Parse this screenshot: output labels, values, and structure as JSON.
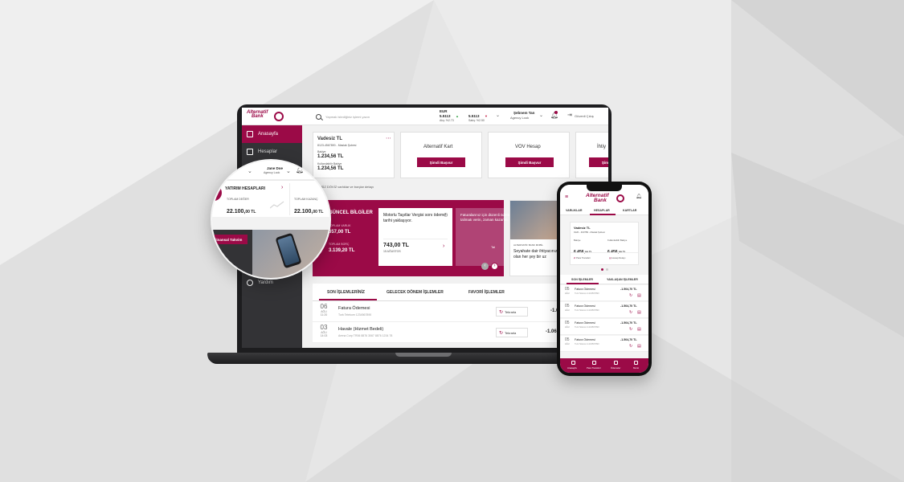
{
  "brand": {
    "name_line1": "Alternatif",
    "name_line2": "Bank",
    "primary_color": "#9b0a47",
    "dark_color": "#333336"
  },
  "laptop": {
    "header": {
      "search_placeholder": "Yapmak istediğiniz işlemi yazın",
      "currency_label": "EUR",
      "rate_buy": "5.5113",
      "rate_buy_sub": "Alış: %2.73",
      "rate_sell": "5.5113",
      "rate_sell_sub": "Satış: %2.50",
      "user_name": "Şebnem Tan",
      "user_role": "Agency Look",
      "logout_label": "Güvenli Çıkış"
    },
    "sidebar": {
      "items": [
        {
          "label": "Anasayfa"
        },
        {
          "label": "Hesaplar"
        },
        {
          "label": "Yardım"
        }
      ]
    },
    "account_card": {
      "title": "Vadesiz TL",
      "account_no": "8123-4567890 - Maslak Şubesi",
      "balance_label": "Bakiye",
      "balance": "1.234,56 TL",
      "available_label": "Kullanılabilir Bakiye",
      "available": "1.234,56 TL"
    },
    "products": [
      {
        "title": "Alternatif Kart",
        "button": "Şimdi Başvur"
      },
      {
        "title": "VOV Hesap",
        "button": "Şimdi Başvur"
      },
      {
        "title": "İhtiy",
        "button": "Şim"
      }
    ],
    "assets_link": "VADESİZ DÖVİZ varlıklar ve borçlar detayı",
    "news": {
      "title": "GÜNCEL BİLGİLER",
      "label1": "TOPLAM VARLIK",
      "value1": "657,00 TL",
      "label2": "TOPLAM BORÇ",
      "value2": "3.139,20 TL",
      "bill_title": "Motorlu Taşıtlar Vergisi sonı ödeme tarihi yaklaşıyor.",
      "bill_amount": "743,00 TL",
      "bill_date": "15 AĞUSTOS",
      "promo_text": "Faturalarınız için düzenli ödeme talimatı verin, zaman kazanın.",
      "promo_link": "Tal",
      "promo2_label": "ALTERNATİF BANK MOBİL",
      "promo2_text": "Seyahate dair ihtiyacınız olan her şey bir uz"
    },
    "tabs": [
      {
        "label": "SON İŞLEMLERİNİZ"
      },
      {
        "label": "GELECEK DÖNEM İŞLEMLER"
      },
      {
        "label": "FAVORİ İŞLEMLER"
      }
    ],
    "transactions": [
      {
        "day": "06",
        "month": "AĞU",
        "time": "11:20",
        "title": "Fatura Ödemesi",
        "desc": "Turk Telekom 1234567890",
        "button": "Tekrarla",
        "amount": "-1.0"
      },
      {
        "day": "03",
        "month": "AĞU",
        "time": "14:03",
        "title": "Havale (Hizmet Bedeli)",
        "desc": "Arena Corp TR06 8876 3067 8876 1234 78",
        "button": "Tekrarla",
        "amount": "-1.06"
      }
    ]
  },
  "magnifier": {
    "user_name": "Jane Doe",
    "user_role": "Agency Look",
    "left_code": "5.5",
    "section_title": "YATIRIM HESAPLARI",
    "left_label": "TOPLAM DEĞER",
    "left_value": "22.100,",
    "left_decimal": "00 TL",
    "right_label": "TOPLAM KAZANÇ",
    "right_value": "22.100,",
    "right_decimal": "00 TL",
    "button": "Finansal Takvim"
  },
  "phone": {
    "tabs": [
      {
        "label": "VARLIKLAR"
      },
      {
        "label": "HESAPLAR"
      },
      {
        "label": "KARTLAR"
      }
    ],
    "account": {
      "title": "Vadesiz TL",
      "account_no": "0120 - 403789 - Maslak Şubesi",
      "balance_label": "Bakiye",
      "balance": "6.456,",
      "balance_dec": "00 TL",
      "available_label": "Kullanılabilir Bakiye",
      "available": "6.456,",
      "available_dec": "00 TL",
      "action1": "Para Transferi",
      "action2": "Hesap Detayı"
    },
    "tx_tabs": [
      {
        "label": "SON İŞLEMLER"
      },
      {
        "label": "YAKLAŞAN İŞLEMLER"
      }
    ],
    "transactions": [
      {
        "day": "05",
        "month": "AĞU",
        "title": "Fatura Ödemesi",
        "desc": "Turk Telekom 1234567890",
        "amount": "-1.504,70 TL"
      },
      {
        "day": "05",
        "month": "AĞU",
        "title": "Fatura Ödemesi",
        "desc": "Turk Telekom 1234567890",
        "amount": "-1.504,70 TL"
      },
      {
        "day": "05",
        "month": "AĞU",
        "title": "Fatura Ödemesi",
        "desc": "Turk Telekom 1234567890",
        "amount": "-1.504,70 TL"
      },
      {
        "day": "05",
        "month": "AĞU",
        "title": "Fatura Ödemesi",
        "desc": "Turk Telekom 1234567890",
        "amount": "-1.504,70 TL"
      }
    ],
    "nav": [
      {
        "label": "Anasayfa"
      },
      {
        "label": "Para Transferi"
      },
      {
        "label": "Ödemeler"
      },
      {
        "label": "Menü"
      }
    ]
  }
}
